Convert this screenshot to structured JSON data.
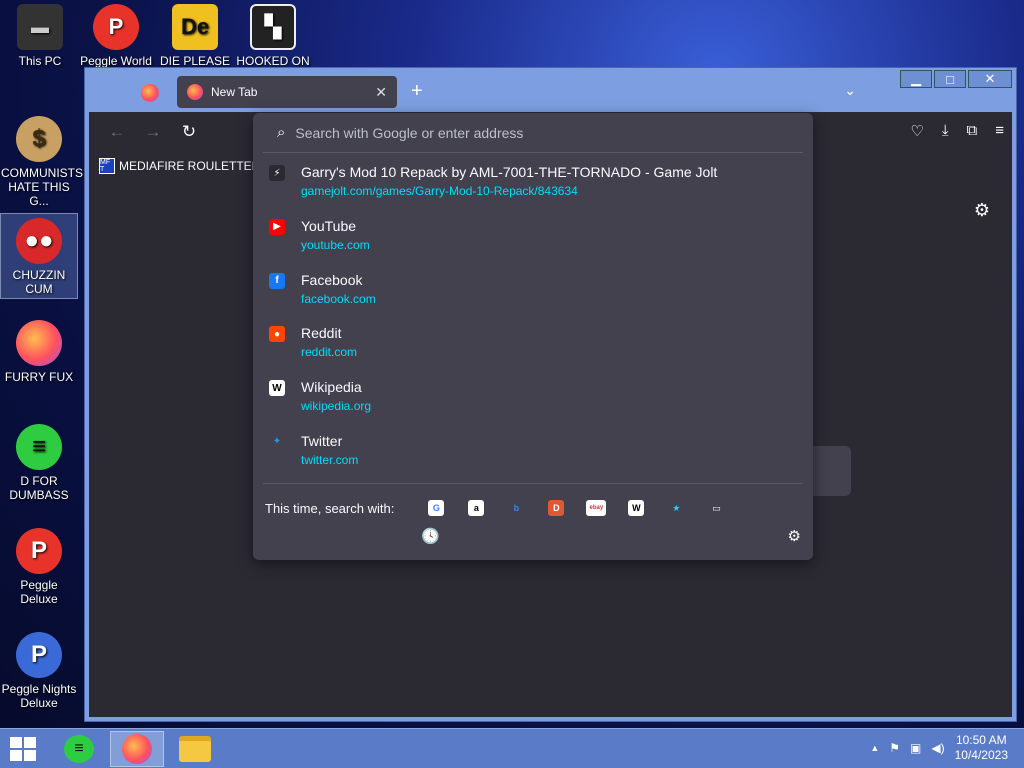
{
  "desktop": {
    "top_icons": [
      {
        "label": "This PC"
      },
      {
        "label": "Peggle World"
      },
      {
        "label": "DIE PLEASE"
      },
      {
        "label": "HOOKED ON"
      }
    ],
    "left_icons": [
      {
        "label": "COMMUNISTS HATE THIS G..."
      },
      {
        "label": "CHUZZIN CUM"
      },
      {
        "label": "FURRY FUX"
      },
      {
        "label": "D FOR DUMBASS"
      },
      {
        "label": "Peggle Deluxe"
      },
      {
        "label": "Peggle Nights Deluxe"
      }
    ]
  },
  "browser": {
    "tab": {
      "title": "New Tab",
      "close": "✕"
    },
    "new_tab": "+",
    "tab_list": "⌄",
    "window_controls": {
      "min": "▁",
      "max": "□",
      "close": "✕"
    },
    "nav": {
      "back": "←",
      "forward": "→",
      "reload": "↻"
    },
    "toolbar_icons": {
      "pocket": "♡",
      "downloads": "⤓",
      "extensions": "⧉",
      "menu": "≡"
    },
    "bookmark": {
      "label": "MEDIAFIRE ROULETTER",
      "icon_text": "MF T"
    },
    "content_gear": "⚙",
    "urlbar": {
      "placeholder": "Search with Google or enter address",
      "value": ""
    },
    "results": [
      {
        "title": "Garry's Mod 10 Repack by AML-7001-THE-TORNADO - Game Jolt",
        "url": "gamejolt.com/games/Garry-Mod-10-Repack/843634",
        "icon": "gamejolt-icon",
        "icon_text": "⚡",
        "icon_bg": "#2b2a33",
        "icon_fg": "#ffffff"
      },
      {
        "title": "YouTube",
        "url": "youtube.com",
        "icon": "youtube-icon",
        "icon_text": "▶",
        "icon_bg": "#ff0000",
        "icon_fg": "#ffffff"
      },
      {
        "title": "Facebook",
        "url": "facebook.com",
        "icon": "facebook-icon",
        "icon_text": "f",
        "icon_bg": "#1877f2",
        "icon_fg": "#ffffff"
      },
      {
        "title": "Reddit",
        "url": "reddit.com",
        "icon": "reddit-icon",
        "icon_text": "●",
        "icon_bg": "#ff4500",
        "icon_fg": "#ffffff"
      },
      {
        "title": "Wikipedia",
        "url": "wikipedia.org",
        "icon": "wikipedia-icon",
        "icon_text": "W",
        "icon_bg": "#ffffff",
        "icon_fg": "#000000"
      },
      {
        "title": "Twitter",
        "url": "twitter.com",
        "icon": "twitter-icon",
        "icon_text": "✦",
        "icon_bg": "#42414d",
        "icon_fg": "#1d9bf0"
      }
    ],
    "oneoff": {
      "label": "This time, search with:",
      "engines": [
        {
          "name": "google-icon",
          "text": "G",
          "bg": "#ffffff",
          "fg": "#4285f4"
        },
        {
          "name": "amazon-icon",
          "text": "a",
          "bg": "#ffffff",
          "fg": "#000000"
        },
        {
          "name": "bing-icon",
          "text": "b",
          "bg": "#42414d",
          "fg": "#2b8cff"
        },
        {
          "name": "duckduckgo-icon",
          "text": "D",
          "bg": "#de5833",
          "fg": "#ffffff"
        },
        {
          "name": "ebay-icon",
          "text": "ebay",
          "bg": "#ffffff",
          "fg": "#e53238"
        },
        {
          "name": "wikipedia-search-icon",
          "text": "W",
          "bg": "#ffffff",
          "fg": "#000000"
        },
        {
          "name": "bookmarks-star-icon",
          "text": "★",
          "bg": "#42414d",
          "fg": "#00ddff"
        },
        {
          "name": "tabs-icon",
          "text": "▭",
          "bg": "#42414d",
          "fg": "#fbfbfe"
        }
      ],
      "history": "🕓",
      "settings": "⚙"
    }
  },
  "taskbar": {
    "clock_time": "10:50 AM",
    "clock_date": "10/4/2023",
    "tray_arrow": "▲",
    "flag": "⚑",
    "network": "▣",
    "volume": "◀)"
  },
  "colors": {
    "accent": "#00ddff",
    "panel": "#42414d",
    "window": "#7d9ee0"
  }
}
